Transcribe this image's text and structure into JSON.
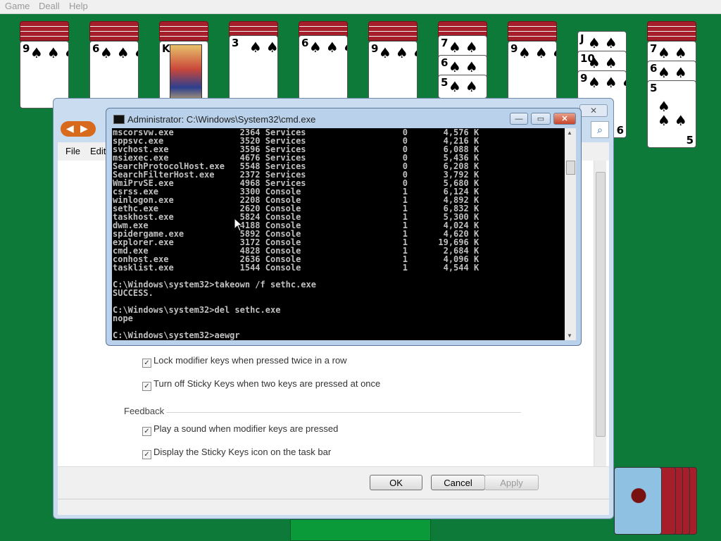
{
  "game_menu": [
    "Game",
    "Deall",
    "Help"
  ],
  "tableau": [
    {
      "rank": "9",
      "suits": "♠♠♠♠♠♠♠♠♠"
    },
    {
      "rank": "6",
      "suits": "♠♠♠♠♠♠"
    },
    {
      "rank": "K",
      "suits": "",
      "face": true
    },
    {
      "rank": "3",
      "suits": "♠♠♠"
    },
    {
      "rank": "6",
      "suits": "♠♠♠♠♠♠"
    },
    {
      "rank": "9",
      "suits": "♠♠♠♠♠♠♠♠♠"
    },
    {
      "ranks": [
        "7",
        "6",
        "5"
      ]
    },
    {
      "rank": "9",
      "suits": "♠♠♠♠♠♠♠♠♠"
    },
    {
      "ranks": [
        "J",
        "10",
        "9"
      ],
      "bottom_rank": "6"
    },
    {
      "ranks": [
        "7",
        "6",
        "5"
      ],
      "bottom_rank": "5"
    }
  ],
  "dialog": {
    "menu": [
      "File",
      "Edit"
    ],
    "close": "✕",
    "options": [
      {
        "label": "Lock modifier keys when pressed twice in a row",
        "checked": true
      },
      {
        "label": "Turn off Sticky Keys when two keys are pressed at once",
        "checked": true
      }
    ],
    "feedback_heading": "Feedback",
    "feedback_options": [
      {
        "label": "Play a sound when modifier keys are pressed",
        "checked": true
      },
      {
        "label": "Display the Sticky Keys icon on the task bar",
        "checked": true
      }
    ],
    "buttons": {
      "ok": "OK",
      "cancel": "Cancel",
      "apply": "Apply"
    }
  },
  "cmd": {
    "title": "Administrator: C:\\Windows\\System32\\cmd.exe",
    "processes": [
      [
        "mscorsvw.exe",
        "2364",
        "Services",
        "0",
        "4,576 K"
      ],
      [
        "sppsvc.exe",
        "3520",
        "Services",
        "0",
        "4,216 K"
      ],
      [
        "svchost.exe",
        "3596",
        "Services",
        "0",
        "6,088 K"
      ],
      [
        "msiexec.exe",
        "4676",
        "Services",
        "0",
        "5,436 K"
      ],
      [
        "SearchProtocolHost.exe",
        "5548",
        "Services",
        "0",
        "6,208 K"
      ],
      [
        "SearchFilterHost.exe",
        "2372",
        "Services",
        "0",
        "3,792 K"
      ],
      [
        "WmiPrvSE.exe",
        "4968",
        "Services",
        "0",
        "5,680 K"
      ],
      [
        "csrss.exe",
        "3300",
        "Console",
        "1",
        "6,124 K"
      ],
      [
        "winlogon.exe",
        "2208",
        "Console",
        "1",
        "4,892 K"
      ],
      [
        "sethc.exe",
        "2620",
        "Console",
        "1",
        "6,832 K"
      ],
      [
        "taskhost.exe",
        "5824",
        "Console",
        "1",
        "5,300 K"
      ],
      [
        "dwm.exe",
        "4188",
        "Console",
        "1",
        "4,024 K"
      ],
      [
        "spidergame.exe",
        "5892",
        "Console",
        "1",
        "4,620 K"
      ],
      [
        "explorer.exe",
        "3172",
        "Console",
        "1",
        "19,696 K"
      ],
      [
        "cmd.exe",
        "4828",
        "Console",
        "1",
        "2,684 K"
      ],
      [
        "conhost.exe",
        "2636",
        "Console",
        "1",
        "4,096 K"
      ],
      [
        "tasklist.exe",
        "1544",
        "Console",
        "1",
        "4,544 K"
      ]
    ],
    "history": [
      "",
      "C:\\Windows\\system32>takeown /f sethc.exe",
      "SUCCESS.",
      "",
      "C:\\Windows\\system32>del sethc.exe",
      "nope",
      "",
      "C:\\Windows\\system32>aewgr"
    ]
  }
}
